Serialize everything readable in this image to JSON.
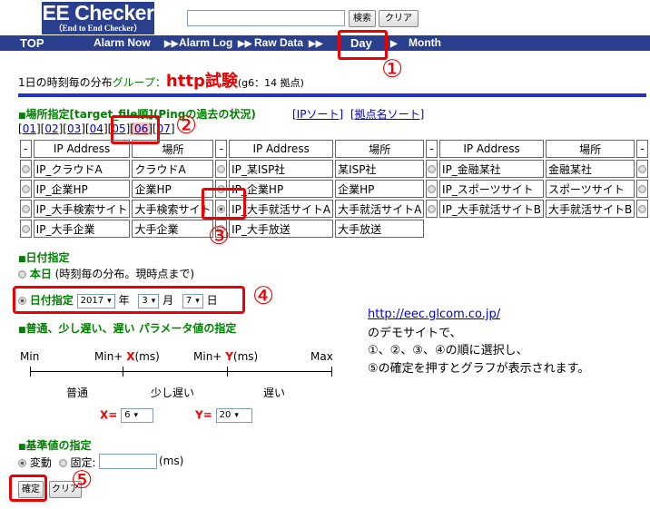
{
  "header": {
    "logo_main": "EE Checker",
    "logo_sub": "（End to End Checker）",
    "search_button": "検索",
    "clear_button": "クリア"
  },
  "nav": {
    "top": "TOP",
    "alarm_now": "Alarm Now",
    "alarm_log": "Alarm Log",
    "raw_data": "Raw Data",
    "day": "Day",
    "month": "Month",
    "arrow": "▶▶"
  },
  "annotations": [
    "①",
    "②",
    "③",
    "④",
    "⑤"
  ],
  "title": {
    "prefix": "1日の時刻毎の分布",
    "group_label": "グループ：",
    "group_name": "http試験",
    "count": "(g6：14 拠点)"
  },
  "location": {
    "section_title": "場所指定[target_file順](Pingの過去の状況)",
    "ip_sort": "[IPソート]",
    "name_sort": "[拠点名ソート]",
    "pages": [
      "01",
      "02",
      "03",
      "04",
      "05",
      "06",
      "07"
    ],
    "current_page": "06",
    "headers": {
      "dash": "-",
      "ip": "IP Address",
      "place": "場所"
    },
    "rows": [
      [
        [
          "IP_クラウドA",
          "クラウドA"
        ],
        [
          "IP_某ISP社",
          "某ISP社"
        ],
        [
          "IP_金融某社",
          "金融某社"
        ]
      ],
      [
        [
          "IP_企業HP",
          "企業HP"
        ],
        [
          "IP_企業HP",
          "企業HP"
        ],
        [
          "IP_スポーツサイト",
          "スポーツサイト"
        ]
      ],
      [
        [
          "IP_大手検索サイト",
          "大手検索サイト"
        ],
        [
          "IP_大手就活サイトA",
          "大手就活サイトA"
        ],
        [
          "IP_大手就活サイトB",
          "大手就活サイトB"
        ]
      ],
      [
        [
          "IP_大手企業",
          "大手企業"
        ],
        [
          "IP_大手放送",
          "大手放送"
        ]
      ]
    ]
  },
  "date": {
    "section_title": "日付指定",
    "today_label": "本日",
    "today_note": "(時刻毎の分布。現時点まで)",
    "specify_label": "日付指定",
    "year": "2017",
    "year_unit": "年",
    "month": "3",
    "month_unit": "月",
    "day": "7",
    "day_unit": "日"
  },
  "params": {
    "section_title": "普通、少し遅い、遅い パラメータ値の指定",
    "min": "Min",
    "min_plus": "Min+",
    "x_label": "X",
    "y_label": "Y",
    "ms": "(ms)",
    "max": "Max",
    "normal": "普通",
    "slightly_slow": "少し遅い",
    "slow": "遅い",
    "x_eq": "X=",
    "x_value": "6",
    "y_eq": "Y=",
    "y_value": "20"
  },
  "baseline": {
    "section_title": "基準値の指定",
    "variable": "変動",
    "fixed": "固定:",
    "ms": "(ms)"
  },
  "buttons": {
    "confirm": "確定",
    "clear": "クリア"
  },
  "info": {
    "url": "http://eec.glcom.co.jp/",
    "line1": "のデモサイトで、",
    "line2": "①、②、③、④の順に選択し、",
    "line3": "⑤の確定を押すとグラフが表示されます。"
  }
}
